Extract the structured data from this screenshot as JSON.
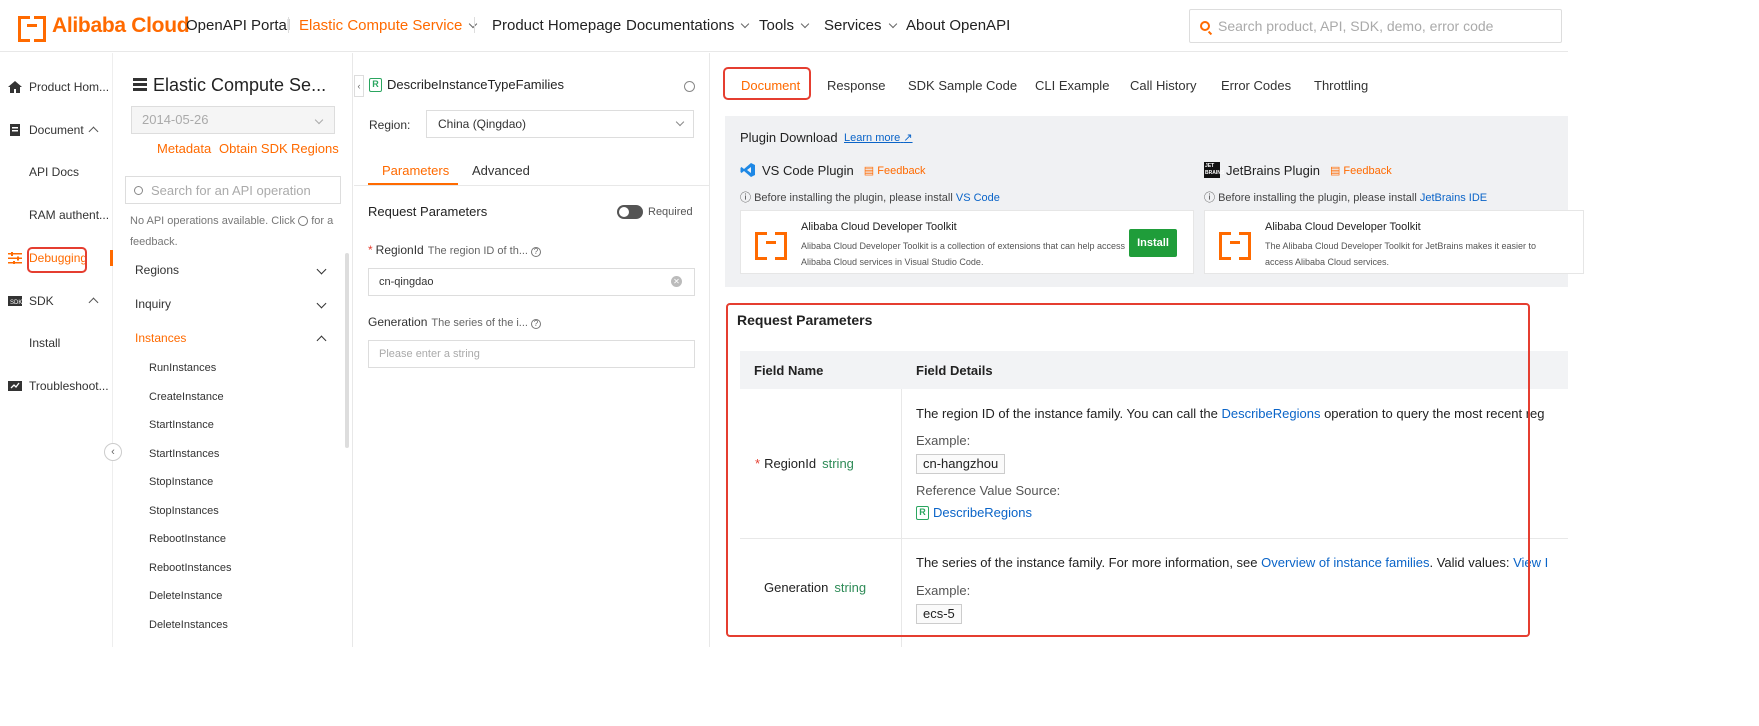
{
  "brand": {
    "logo_text": "Alibaba Cloud"
  },
  "topnav": {
    "portal": "OpenAPI Portal",
    "service": "Elastic Compute Service",
    "product_homepage": "Product Homepage",
    "documentations": "Documentations",
    "tools": "Tools",
    "services": "Services",
    "about": "About OpenAPI",
    "search_placeholder": "Search product, API, SDK, demo, error code"
  },
  "sidenav": {
    "items": [
      {
        "label": "Product Hom...",
        "icon": "home-icon"
      },
      {
        "label": "Document",
        "icon": "document-icon"
      },
      {
        "label": "API Docs"
      },
      {
        "label": "RAM authent..."
      },
      {
        "label": "Debugging",
        "icon": "debugging-icon"
      },
      {
        "label": "SDK",
        "icon": "sdk-icon"
      },
      {
        "label": "Install"
      },
      {
        "label": "Troubleshoot...",
        "icon": "troubleshoot-icon"
      }
    ]
  },
  "apilist": {
    "service_title": "Elastic Compute Se...",
    "version": "2014-05-26",
    "links": [
      "Metadata",
      "Obtain SDK",
      "Regions"
    ],
    "search_placeholder": "Search for an API operation",
    "empty_note_1": "No API operations available. Click",
    "empty_note_2": "for a feedback.",
    "categories": [
      "Regions",
      "Inquiry",
      "Instances"
    ],
    "operations": [
      "RunInstances",
      "CreateInstance",
      "StartInstance",
      "StartInstances",
      "StopInstance",
      "StopInstances",
      "RebootInstance",
      "RebootInstances",
      "DeleteInstance",
      "DeleteInstances"
    ]
  },
  "form": {
    "operation": "DescribeInstanceTypeFamilies",
    "region_label": "Region:",
    "region_value": "China (Qingdao)",
    "tabs": [
      "Parameters",
      "Advanced"
    ],
    "request_params_title": "Request Parameters",
    "required_label": "Required",
    "params": [
      {
        "name": "RegionId",
        "desc": "The region ID of th...",
        "value": "cn-qingdao",
        "required": true
      },
      {
        "name": "Generation",
        "desc": "The series of the i...",
        "placeholder": "Please enter a string",
        "required": false
      }
    ]
  },
  "doc": {
    "tabs": [
      "Document",
      "Response",
      "SDK Sample Code",
      "CLI Example",
      "Call History",
      "Error Codes",
      "Throttling"
    ],
    "plugin_download": "Plugin Download",
    "learn_more": "Learn more",
    "vscode": {
      "name": "VS Code Plugin",
      "feedback": "Feedback",
      "note_prefix": "Before installing the plugin, please install",
      "note_link": "VS Code",
      "card_title": "Alibaba Cloud Developer Toolkit",
      "card_desc": "Alibaba Cloud Developer Toolkit is a collection of extensions that can help access Alibaba Cloud services in Visual Studio Code.",
      "install": "Install"
    },
    "jetbrains": {
      "name": "JetBrains Plugin",
      "feedback": "Feedback",
      "note_prefix": "Before installing the plugin, please install",
      "note_link": "JetBrains IDE",
      "card_title": "Alibaba Cloud Developer Toolkit",
      "card_desc": "The Alibaba Cloud Developer Toolkit for JetBrains makes it easier to access Alibaba Cloud services."
    },
    "request_params_heading": "Request Parameters",
    "table_headers": [
      "Field Name",
      "Field Details"
    ],
    "fields": [
      {
        "name": "RegionId",
        "type": "string",
        "required": true,
        "desc_prefix": "The region ID of the instance family. You can call the",
        "desc_link": "DescribeRegions",
        "desc_suffix": "operation to query the most recent reg",
        "example_label": "Example:",
        "example": "cn-hangzhou",
        "ref_label": "Reference Value Source:",
        "ref_link": "DescribeRegions"
      },
      {
        "name": "Generation",
        "type": "string",
        "required": false,
        "desc_prefix": "The series of the instance family. For more information, see",
        "desc_link": "Overview of instance families",
        "desc_suffix": ". Valid values:",
        "desc_link2": "View I",
        "example_label": "Example:",
        "example": "ecs-5"
      }
    ]
  },
  "colors": {
    "accent": "#ff6a00",
    "highlight": "#e53e30",
    "link": "#0a64c8",
    "install": "#1f9d3a",
    "type": "#2e8b57"
  }
}
